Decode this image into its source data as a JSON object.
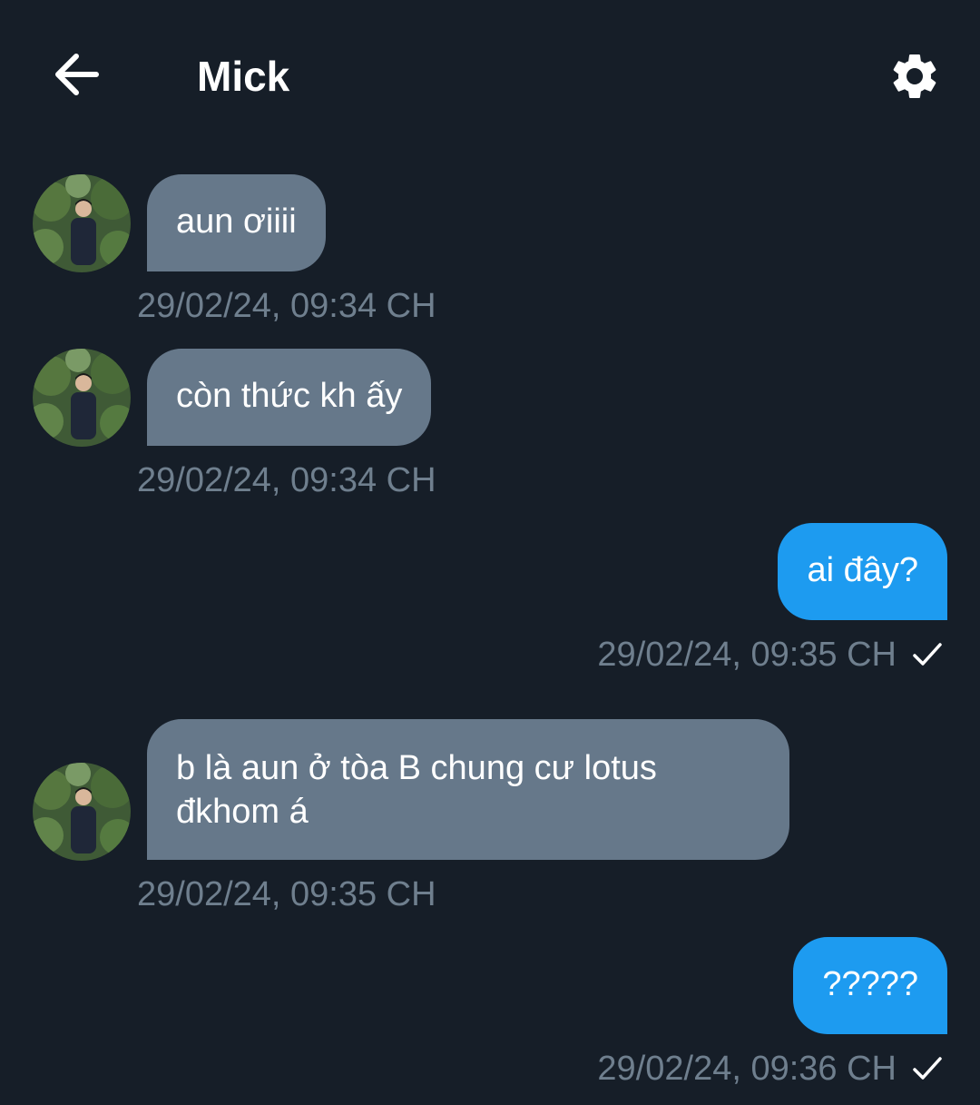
{
  "header": {
    "title": "Mick",
    "back_icon": "arrow-left-icon",
    "settings_icon": "gear-icon"
  },
  "colors": {
    "background": "#161e28",
    "incoming_bubble": "#66788a",
    "outgoing_bubble": "#1d9bf0",
    "timestamp": "#6f7f8e"
  },
  "messages": [
    {
      "direction": "in",
      "text": "aun ơiiii",
      "time": "29/02/24, 09:34 CH"
    },
    {
      "direction": "in",
      "text": "còn thức kh ấy",
      "time": "29/02/24, 09:34 CH"
    },
    {
      "direction": "out",
      "text": "ai đây?",
      "time": "29/02/24, 09:35 CH",
      "status_icon": "check-icon"
    },
    {
      "direction": "in",
      "text": "b là aun ở tòa B chung cư lotus\nđkhom á",
      "time": "29/02/24, 09:35 CH"
    },
    {
      "direction": "out",
      "text": "?????",
      "time": "29/02/24, 09:36 CH",
      "status_icon": "check-icon"
    }
  ]
}
